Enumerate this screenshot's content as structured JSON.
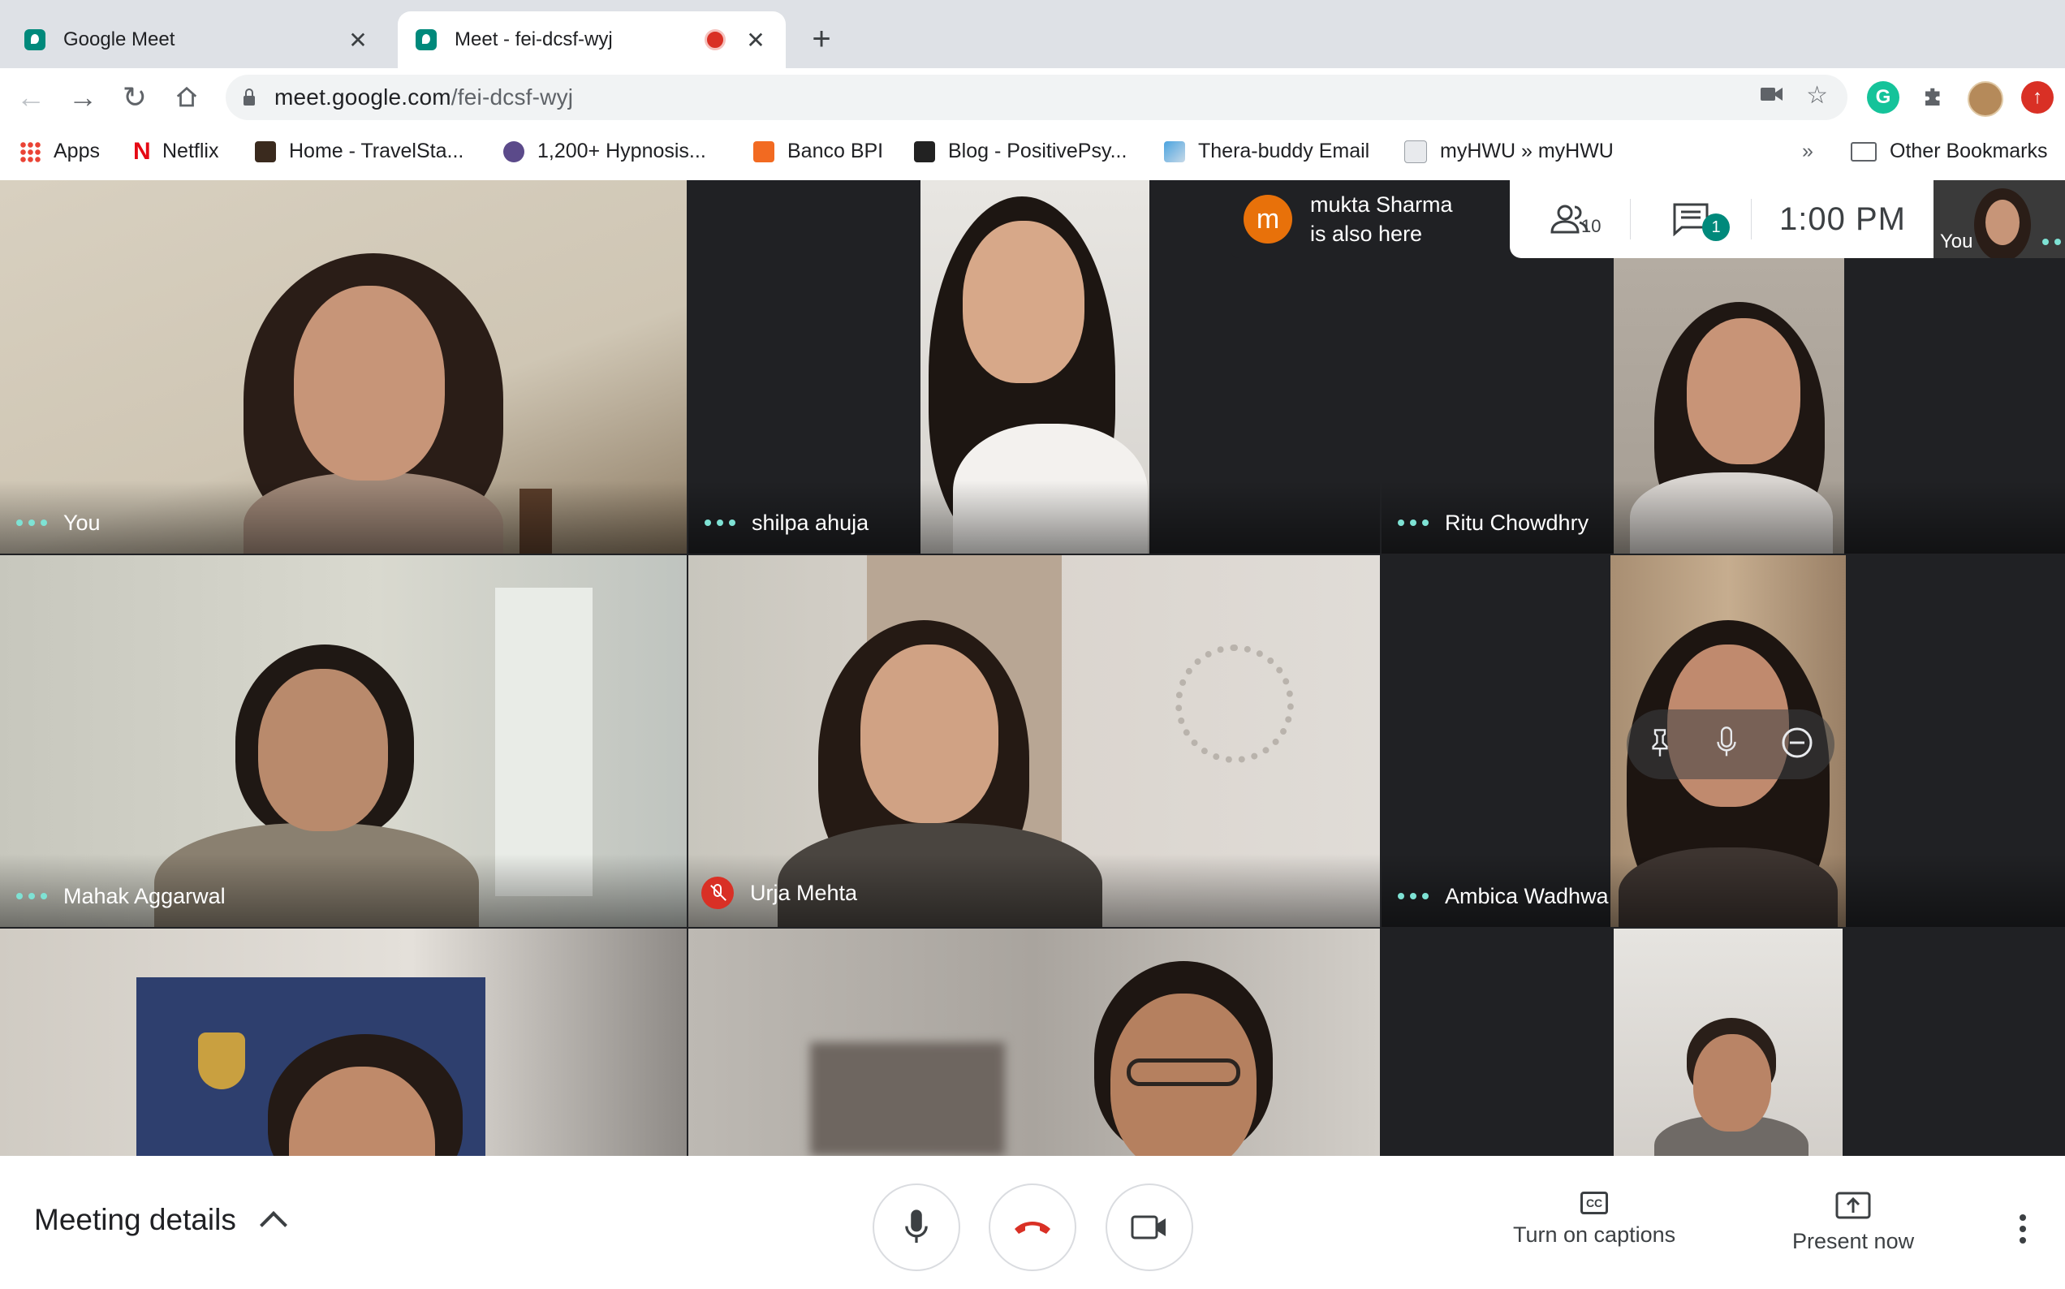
{
  "browser": {
    "tabs": [
      {
        "title": "Google Meet",
        "close": "✕"
      },
      {
        "title": "Meet - fei-dcsf-wyj",
        "close": "✕"
      }
    ],
    "new_tab": "+",
    "url_host": "meet.google.com",
    "url_path": "/fei-dcsf-wyj",
    "bookmarks": [
      {
        "label": "Apps",
        "icon": "apps-grid-icon"
      },
      {
        "label": "Netflix",
        "icon": "netflix-icon"
      },
      {
        "label": "Home - TravelSta...",
        "icon": "travelstart-icon"
      },
      {
        "label": "1,200+ Hypnosis...",
        "icon": "hypnosis-icon"
      },
      {
        "label": "Banco BPI",
        "icon": "banco-bpi-icon"
      },
      {
        "label": "Blog - PositivePsy...",
        "icon": "positivepsy-icon"
      },
      {
        "label": "Thera-buddy Email",
        "icon": "thera-buddy-icon"
      },
      {
        "label": "myHWU » myHWU",
        "icon": "hwu-icon"
      }
    ],
    "more_bookmarks": "»",
    "other_bookmarks": "Other Bookmarks",
    "extension_grammarly": "G"
  },
  "meet": {
    "participants": [
      {
        "name": "You"
      },
      {
        "name": "shilpa ahuja"
      },
      {
        "name": "Ritu Chowdhry"
      },
      {
        "name": "Mahak Aggarwal"
      },
      {
        "name": "Urja Mehta"
      },
      {
        "name": "Ambica Wadhwa"
      }
    ],
    "notification": {
      "avatar_letter": "m",
      "line1": "mukta Sharma",
      "line2": "is also here"
    },
    "people_count": "10",
    "chat_badge": "1",
    "time": "1:00 PM",
    "self_view_label": "You",
    "meeting_details": "Meeting details",
    "captions_label": "Turn on captions",
    "captions_icon_text": "CC",
    "present_label": "Present now"
  },
  "colors": {
    "accent_teal": "#00897b",
    "dots": "#7ee2d4",
    "end_call_red": "#d93025",
    "notice_avatar": "#e8710a"
  }
}
